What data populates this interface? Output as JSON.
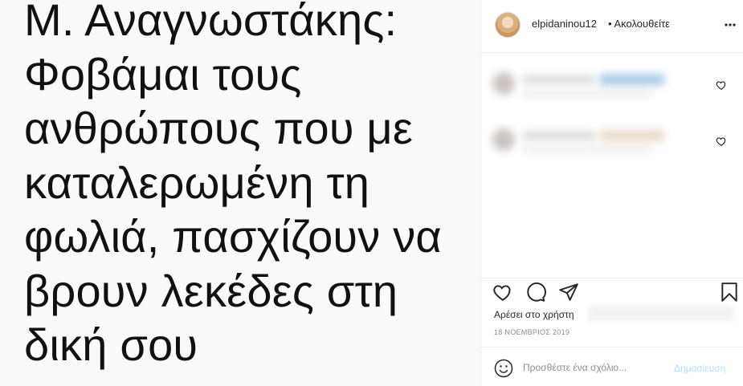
{
  "post": {
    "text_lines": [
      "Μ. Αναγνωστάκης:",
      "Φοβάμαι τους",
      "ανθρώπους που με",
      "καταλερωμένη τη",
      "φωλιά, πασχίζουν να",
      "βρουν λεκέδες στη",
      "δική σου"
    ]
  },
  "header": {
    "username": "elpidaninou12",
    "follow_label": "• Ακολουθείτε",
    "avatar_icon": "profile-avatar",
    "more_icon": "ellipsis-icon"
  },
  "actions": {
    "like_icon": "heart-outline-icon",
    "comment_icon": "speech-bubble-icon",
    "share_icon": "paper-plane-icon",
    "save_icon": "bookmark-icon",
    "likes_text": "Αρέσει στο χρήστη",
    "date": "18 ΝΟΕΜΒΡΙΟΣ 2019"
  },
  "add_comment": {
    "placeholder": "Προσθέστε ένα σχόλιο...",
    "post_label": "Δημοσίευση"
  },
  "colors": {
    "accent_disabled": "#b2dffc",
    "text": "#262626",
    "muted": "#8e8e8e",
    "border": "#efefef"
  }
}
